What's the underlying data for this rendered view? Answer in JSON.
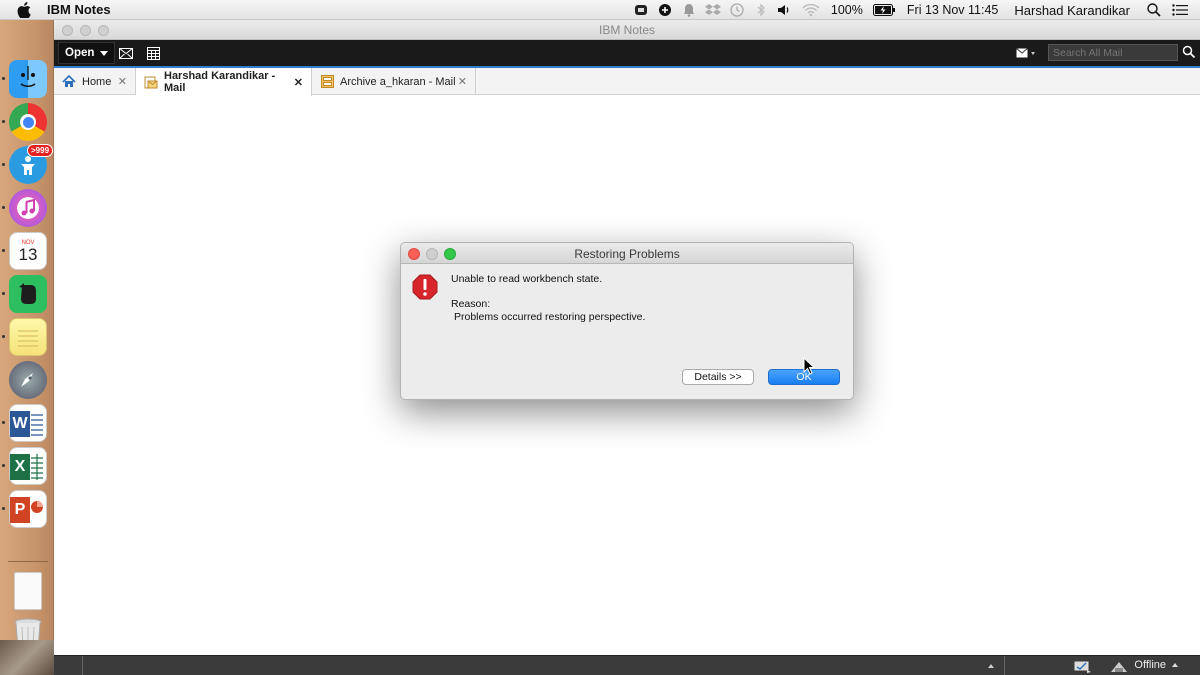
{
  "menubar": {
    "app_name": "IBM Notes",
    "battery": "100%",
    "datetime": "Fri 13 Nov  11:45",
    "user": "Harshad Karandikar",
    "icons": [
      "apple-icon",
      "app-status-icon",
      "sync-icon",
      "notification-icon",
      "dropbox-icon",
      "time-machine-icon",
      "bluetooth-icon",
      "volume-icon",
      "wifi-icon",
      "battery-icon",
      "spotlight-icon",
      "notification-center-icon"
    ]
  },
  "dock": {
    "items": [
      "finder",
      "chrome",
      "app-store-notification",
      "itunes",
      "calendar",
      "evernote",
      "notes",
      "launchpad",
      "word",
      "excel",
      "powerpoint",
      "document",
      "trash"
    ],
    "badge": ">999",
    "calendar_month": "NOV",
    "calendar_day": "13"
  },
  "window": {
    "title": "IBM Notes",
    "toolbar": {
      "open_label": "Open",
      "search_placeholder": "Search All Mail"
    },
    "tabs": [
      {
        "label": "Home",
        "icon": "home-icon",
        "active": false
      },
      {
        "label": "Harshad Karandikar - Mail",
        "icon": "mail-icon",
        "active": true
      },
      {
        "label": "Archive a_hkaran - Mail",
        "icon": "archive-icon",
        "active": false
      }
    ],
    "statusbar": {
      "status": "Offline"
    }
  },
  "dialog": {
    "title": "Restoring Problems",
    "message": "Unable to read workbench state.",
    "reason_label": "Reason:",
    "reason_text": "Problems occurred restoring perspective.",
    "details_button": "Details >>",
    "ok_button": "OK"
  },
  "colors": {
    "accent_blue": "#2f7fd3",
    "ok_button": "#1a7ef0",
    "error_red": "#d7262b"
  }
}
